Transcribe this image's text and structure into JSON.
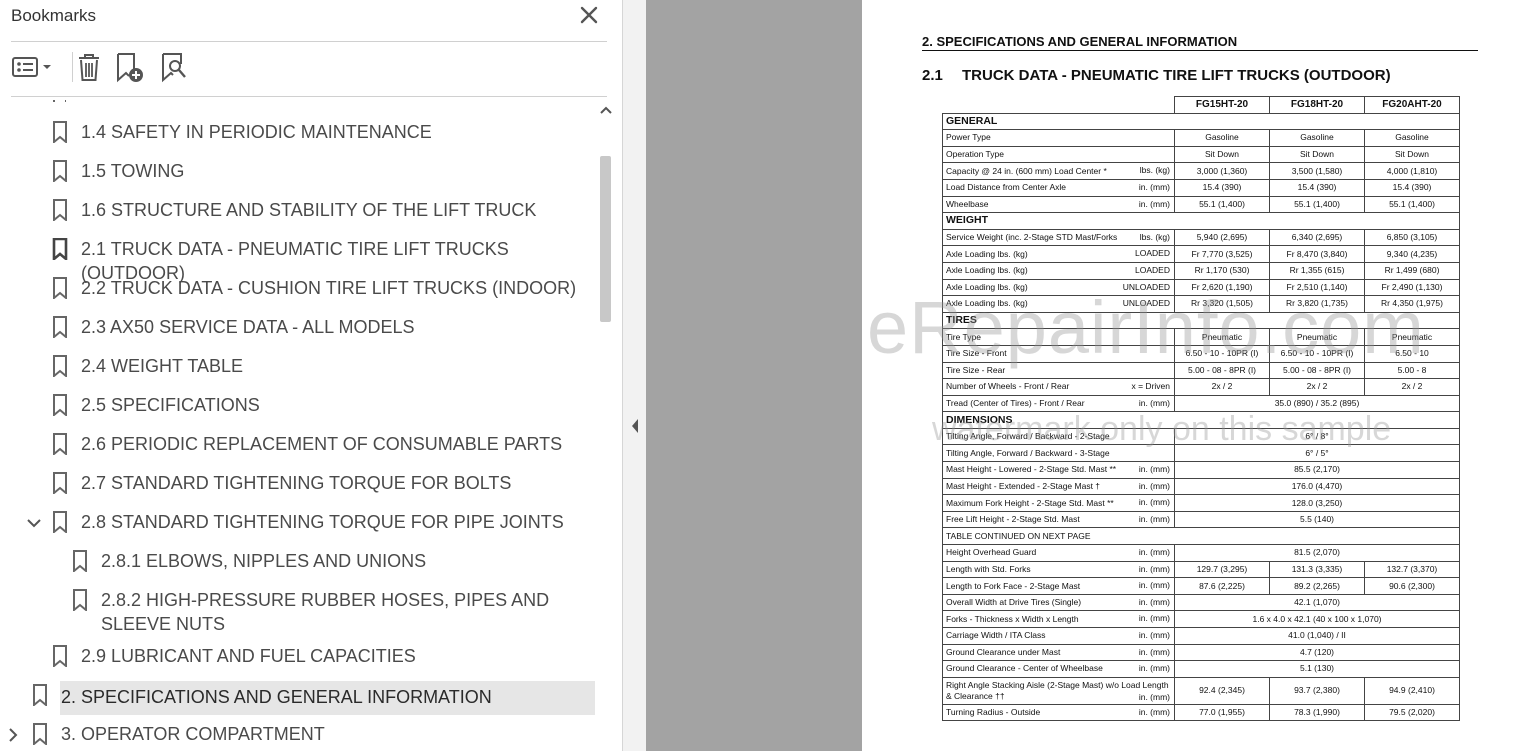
{
  "bookmarks_panel": {
    "title": "Bookmarks",
    "items": [
      {
        "label": "1.4 SAFETY IN PERIODIC MAINTENANCE"
      },
      {
        "label": "1.5 TOWING"
      },
      {
        "label": "1.6 STRUCTURE AND STABILITY OF THE LIFT TRUCK"
      },
      {
        "label": "2.1 TRUCK DATA - PNEUMATIC TIRE LIFT TRUCKS (OUTDOOR)"
      },
      {
        "label": "2.2 TRUCK DATA - CUSHION TIRE LIFT TRUCKS (INDOOR)"
      },
      {
        "label": "2.3 AX50 SERVICE DATA - ALL MODELS"
      },
      {
        "label": "2.4 WEIGHT TABLE"
      },
      {
        "label": "2.5 SPECIFICATIONS"
      },
      {
        "label": "2.6 PERIODIC REPLACEMENT OF CONSUMABLE PARTS"
      },
      {
        "label": "2.7 STANDARD TIGHTENING TORQUE FOR BOLTS"
      },
      {
        "label": "2.8 STANDARD TIGHTENING TORQUE FOR PIPE JOINTS"
      },
      {
        "label": "2.8.1 ELBOWS, NIPPLES AND UNIONS"
      },
      {
        "label": "2.8.2 HIGH-PRESSURE RUBBER HOSES, PIPES AND SLEEVE NUTS"
      },
      {
        "label": "2.9 LUBRICANT AND FUEL CAPACITIES"
      },
      {
        "label": "2. SPECIFICATIONS AND GENERAL INFORMATION"
      },
      {
        "label": "3. OPERATOR COMPARTMENT"
      }
    ]
  },
  "document": {
    "section_title": "2. SPECIFICATIONS AND GENERAL INFORMATION",
    "subsection_number": "2.1",
    "subsection_title": "TRUCK DATA - PNEUMATIC TIRE LIFT TRUCKS (OUTDOOR)",
    "columns": [
      "FG15HT-20",
      "FG18HT-20",
      "FG20AHT-20"
    ],
    "watermark_main": "eRepairInfo.com",
    "watermark_sub": "watermark only on this sample",
    "rows": [
      {
        "type": "group",
        "label": "GENERAL"
      },
      {
        "label": "Power Type",
        "unit": "",
        "values": [
          "Gasoline",
          "Gasoline",
          "Gasoline"
        ]
      },
      {
        "label": "Operation Type",
        "unit": "",
        "values": [
          "Sit Down",
          "Sit Down",
          "Sit Down"
        ]
      },
      {
        "label": "Capacity @ 24 in. (600 mm) Load Center *",
        "unit": "lbs. (kg)",
        "values": [
          "3,000 (1,360)",
          "3,500 (1,580)",
          "4,000 (1,810)"
        ]
      },
      {
        "label": "Load Distance from Center Axle",
        "unit": "in. (mm)",
        "values": [
          "15.4 (390)",
          "15.4 (390)",
          "15.4 (390)"
        ]
      },
      {
        "label": "Wheelbase",
        "unit": "in. (mm)",
        "values": [
          "55.1 (1,400)",
          "55.1 (1,400)",
          "55.1 (1,400)"
        ]
      },
      {
        "type": "group",
        "label": "WEIGHT"
      },
      {
        "label": "Service Weight (inc. 2-Stage STD Mast/Forks",
        "unit": "lbs. (kg)",
        "values": [
          "5,940 (2,695)",
          "6,340 (2,695)",
          "6,850 (3,105)"
        ]
      },
      {
        "label": "Axle Loading          lbs. (kg)",
        "unit": "LOADED",
        "values": [
          "Fr 7,770 (3,525)",
          "Fr 8,470 (3,840)",
          "9,340 (4,235)"
        ]
      },
      {
        "label": "Axle Loading          lbs. (kg)",
        "unit": "LOADED",
        "values": [
          "Rr 1,170 (530)",
          "Rr 1,355 (615)",
          "Rr 1,499 (680)"
        ]
      },
      {
        "label": "Axle Loading          lbs. (kg)",
        "unit": "UNLOADED",
        "values": [
          "Fr 2,620 (1,190)",
          "Fr 2,510 (1,140)",
          "Fr 2,490 (1,130)"
        ]
      },
      {
        "label": "Axle Loading          lbs. (kg)",
        "unit": "UNLOADED",
        "values": [
          "Rr 3,320 (1,505)",
          "Rr 3,820 (1,735)",
          "Rr 4,350 (1,975)"
        ]
      },
      {
        "type": "group",
        "label": "TIRES"
      },
      {
        "label": "Tire Type",
        "unit": "",
        "values": [
          "Pneumatic",
          "Pneumatic",
          "Pneumatic"
        ]
      },
      {
        "label": "Tire Size - Front",
        "unit": "",
        "values": [
          "6.50 - 10 - 10PR (I)",
          "6.50 - 10 - 10PR (I)",
          "6.50 - 10"
        ]
      },
      {
        "label": "Tire Size - Rear",
        "unit": "",
        "values": [
          "5.00 - 08 - 8PR (I)",
          "5.00 - 08 - 8PR (I)",
          "5.00 - 8"
        ]
      },
      {
        "label": "Number of Wheels - Front / Rear",
        "unit": "x = Driven",
        "values": [
          "2x / 2",
          "2x / 2",
          "2x / 2"
        ]
      },
      {
        "label": "Tread (Center of Tires) - Front / Rear",
        "unit": "in. (mm)",
        "merged": "35.0 (890) / 35.2 (895)"
      },
      {
        "type": "group",
        "label": "DIMENSIONS"
      },
      {
        "label": "Tilting Angle, Forward / Backward - 2-Stage",
        "unit": "",
        "merged": "6° / 8°"
      },
      {
        "label": "Tilting Angle, Forward / Backward - 3-Stage",
        "unit": "",
        "merged": "6° / 5°"
      },
      {
        "label": "Mast Height - Lowered - 2-Stage Std. Mast **",
        "unit": "in. (mm)",
        "merged": "85.5 (2,170)"
      },
      {
        "label": "Mast Height - Extended - 2-Stage Mast †",
        "unit": "in. (mm)",
        "merged": "176.0 (4,470)"
      },
      {
        "label": "Maximum Fork Height - 2-Stage Std. Mast **",
        "unit": "in. (mm)",
        "merged": "128.0 (3,250)"
      },
      {
        "label": "Free Lift Height - 2-Stage Std. Mast",
        "unit": "in. (mm)",
        "merged": "5.5 (140)"
      },
      {
        "type": "note",
        "label": "TABLE CONTINUED ON NEXT PAGE"
      },
      {
        "label": "Height Overhead Guard",
        "unit": "in. (mm)",
        "merged": "81.5 (2,070)"
      },
      {
        "label": "Length with Std. Forks",
        "unit": "in. (mm)",
        "values": [
          "129.7 (3,295)",
          "131.3 (3,335)",
          "132.7 (3,370)"
        ]
      },
      {
        "label": "Length to Fork Face - 2-Stage Mast",
        "unit": "in. (mm)",
        "values": [
          "87.6 (2,225)",
          "89.2 (2,265)",
          "90.6 (2,300)"
        ]
      },
      {
        "label": "Overall Width at Drive Tires     (Single)",
        "unit": "in. (mm)",
        "merged": "42.1 (1,070)"
      },
      {
        "label": "Forks - Thickness x Width x Length",
        "unit": "in. (mm)",
        "merged": "1.6 x 4.0 x 42.1 (40 x 100 x 1,070)"
      },
      {
        "label": "Carriage Width / ITA Class",
        "unit": "in. (mm)",
        "merged": "41.0 (1,040) / II"
      },
      {
        "label": "Ground Clearance under Mast",
        "unit": "in. (mm)",
        "merged": "4.7 (120)"
      },
      {
        "label": "Ground Clearance - Center of Wheelbase",
        "unit": "in. (mm)",
        "merged": "5.1 (130)"
      },
      {
        "label": "Right Angle Stacking Aisle (2-Stage Mast) w/o Load Length & Clearance ††",
        "unit": "in. (mm)",
        "values": [
          "92.4 (2,345)",
          "93.7 (2,380)",
          "94.9 (2,410)"
        ],
        "tall": true
      },
      {
        "label": "Turning Radius - Outside",
        "unit": "in. (mm)",
        "values": [
          "77.0 (1,955)",
          "78.3 (1,990)",
          "79.5 (2,020)"
        ]
      }
    ]
  }
}
